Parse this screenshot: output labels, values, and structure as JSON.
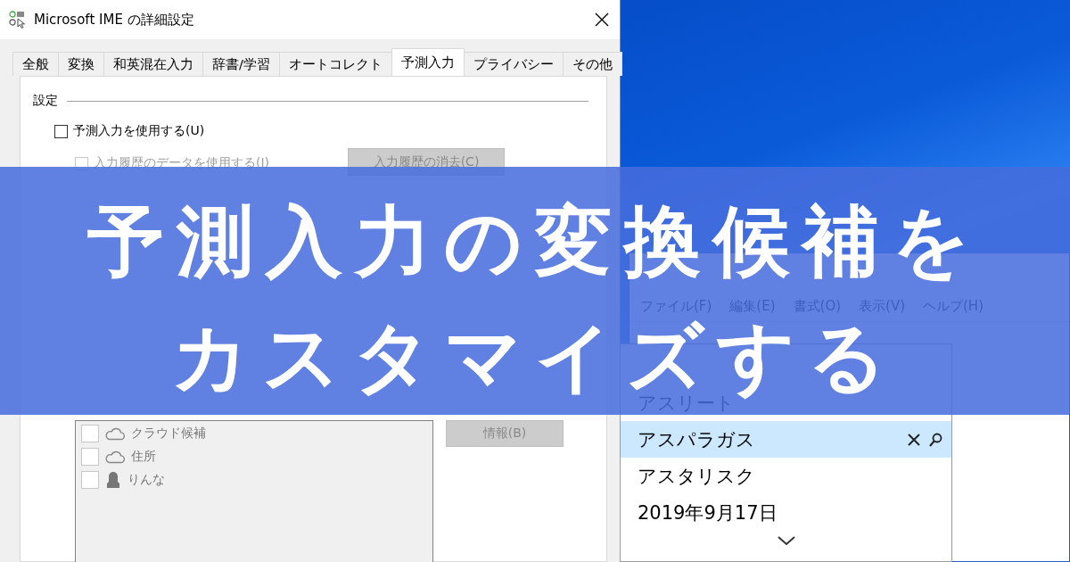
{
  "dialog": {
    "title": "Microsoft IME の詳細設定",
    "tabs": [
      {
        "label": "全般",
        "selected": false
      },
      {
        "label": "変換",
        "selected": false
      },
      {
        "label": "和英混在入力",
        "selected": false
      },
      {
        "label": "辞書/学習",
        "selected": false
      },
      {
        "label": "オートコレクト",
        "selected": false
      },
      {
        "label": "予測入力",
        "selected": true
      },
      {
        "label": "プライバシー",
        "selected": false
      },
      {
        "label": "その他",
        "selected": false
      }
    ],
    "section_label": "設定",
    "main_option": {
      "label": "予測入力を使用する(U)",
      "checked": false,
      "disabled": false
    },
    "sub_options": [
      {
        "label": "入力履歴のデータを使用する(I)",
        "checked": false,
        "disabled": true
      }
    ],
    "clear_history_button": {
      "label": "入力履歴の消去(C)",
      "disabled": true
    },
    "services": {
      "disabled": true,
      "items": [
        {
          "label": "クラウド候補",
          "checked": false,
          "kind": "cloud"
        },
        {
          "label": "住所",
          "checked": false,
          "kind": "cloud"
        },
        {
          "label": "りんな",
          "checked": false,
          "kind": "person"
        }
      ]
    },
    "info_button": {
      "label": "情報(B)",
      "disabled": true
    }
  },
  "notepad": {
    "menu": [
      "ファイル(F)",
      "編集(E)",
      "書式(O)",
      "表示(V)",
      "ヘルプ(H)"
    ]
  },
  "candidates": {
    "items": [
      {
        "label": "アスリート",
        "selected": false
      },
      {
        "label": "アスパラガス",
        "selected": true
      },
      {
        "label": "アスタリスク",
        "selected": false
      },
      {
        "label": "2019年9月17日",
        "selected": false
      }
    ]
  },
  "banner": {
    "lines": [
      "予測入力の変換候補を",
      "カスタマイズする"
    ]
  }
}
